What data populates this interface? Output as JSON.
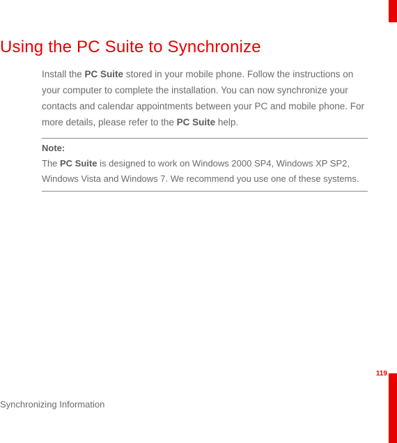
{
  "heading": "Using the PC Suite to Synchronize",
  "body": {
    "pre1": "Install the ",
    "bold1": "PC Suite",
    "mid1": " stored in your mobile phone. Follow the instructions on your computer to complete the installation. You can now synchronize your contacts and calendar appointments between your PC and mobile phone. For more details, please refer to the ",
    "bold2": "PC Suite",
    "post1": " help."
  },
  "note": {
    "label": "Note:",
    "pre": "The ",
    "bold": "PC Suite",
    "post": " is designed to work on Windows 2000 SP4, Windows XP SP2, Windows Vista and Windows 7. We recommend you use one of these systems."
  },
  "footer": "Synchronizing Information",
  "page_number": "119"
}
